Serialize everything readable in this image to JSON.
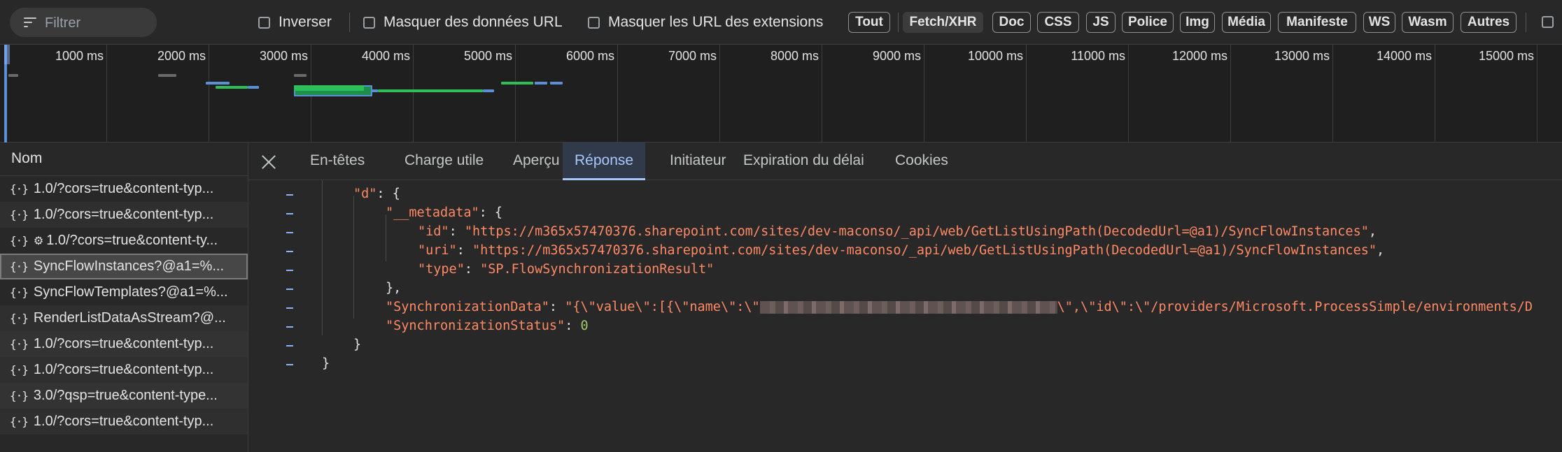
{
  "filterbar": {
    "filter_placeholder": "Filtrer",
    "checkbox_invert": "Inverser",
    "checkbox_hide_data_urls": "Masquer des données URL",
    "checkbox_hide_extension_urls": "Masquer les URL des extensions",
    "types": [
      "Tout",
      "Fetch/XHR",
      "Doc",
      "CSS",
      "JS",
      "Police",
      "Img",
      "Média",
      "Manifeste",
      "WS",
      "Wasm",
      "Autres"
    ],
    "active_type": "Fetch/XHR"
  },
  "timeline": {
    "ticks": [
      "1000 ms",
      "2000 ms",
      "3000 ms",
      "4000 ms",
      "5000 ms",
      "6000 ms",
      "7000 ms",
      "8000 ms",
      "9000 ms",
      "10000 ms",
      "11000 ms",
      "12000 ms",
      "13000 ms",
      "14000 ms",
      "15000 ms"
    ]
  },
  "requests": {
    "header": "Nom",
    "items": [
      "1.0/?cors=true&content-typ...",
      "1.0/?cors=true&content-typ...",
      "1.0/?cors=true&content-ty...",
      "SyncFlowInstances?@a1=%...",
      "SyncFlowTemplates?@a1=%...",
      "RenderListDataAsStream?@...",
      "1.0/?cors=true&content-typ...",
      "1.0/?cors=true&content-typ...",
      "3.0/?qsp=true&content-type...",
      "1.0/?cors=true&content-typ..."
    ],
    "selected_index": 3
  },
  "tabs": {
    "labels": [
      "En-têtes",
      "Charge utile",
      "Aperçu",
      "Réponse",
      "Initiateur",
      "Expiration du délai",
      "Cookies"
    ],
    "active": "Réponse"
  },
  "response": {
    "k_d": "\"d\"",
    "k_metadata": "\"__metadata\"",
    "k_id": "\"id\"",
    "v_id": "\"https://m365x57470376.sharepoint.com/sites/dev-maconso/_api/web/GetListUsingPath(DecodedUrl=@a1)/SyncFlowInstances\"",
    "k_uri": "\"uri\"",
    "v_uri": "\"https://m365x57470376.sharepoint.com/sites/dev-maconso/_api/web/GetListUsingPath(DecodedUrl=@a1)/SyncFlowInstances\"",
    "k_type": "\"type\"",
    "v_type": "\"SP.FlowSynchronizationResult\"",
    "k_syncdata": "\"SynchronizationData\"",
    "v_syncdata_start": "\"{\\\"value\\\":[{\\\"name\\\":\\\"",
    "v_syncdata_end": "\\\",\\\"id\\\":\\\"/providers/Microsoft.ProcessSimple/environments/D",
    "k_syncstatus": "\"SynchronizationStatus\"",
    "v_syncstatus": "0"
  },
  "colors": {
    "active_tab": "#a8c7fa",
    "json_key": "#ff8a65",
    "json_number": "#9ccc65",
    "timeline_blue": "#5b8fd6",
    "timeline_green": "#2fbf5a"
  }
}
